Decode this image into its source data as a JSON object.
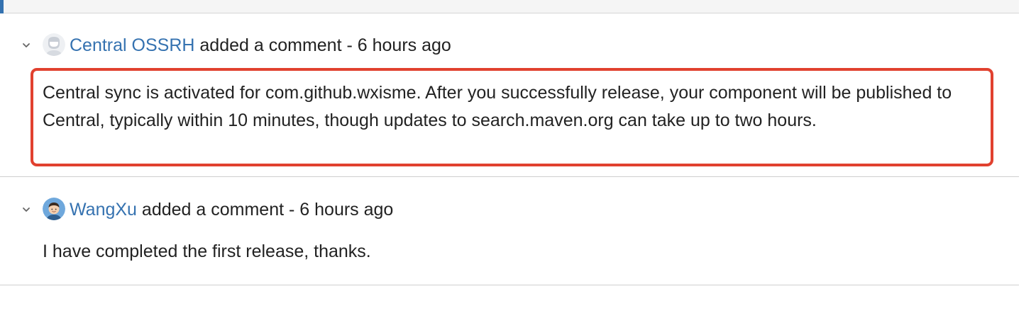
{
  "comments": [
    {
      "author": "Central OSSRH",
      "action": "added a comment",
      "separator": "-",
      "time": "6 hours ago",
      "body": "Central sync is activated for com.github.wxisme. After you successfully release, your component will be published to Central, typically within 10 minutes, though updates to search.maven.org can take up to two hours.",
      "avatar_icon": "default-avatar-icon",
      "highlighted": true,
      "highlight_color": "#e1412f"
    },
    {
      "author": "WangXu",
      "action": "added a comment",
      "separator": "-",
      "time": "6 hours ago",
      "body": "I have completed the first release, thanks.",
      "avatar_icon": "user-avatar-icon",
      "highlighted": false
    }
  ],
  "colors": {
    "link": "#3572b0",
    "accent": "#3572b0",
    "text": "#222222",
    "divider": "#cfcfcf"
  }
}
